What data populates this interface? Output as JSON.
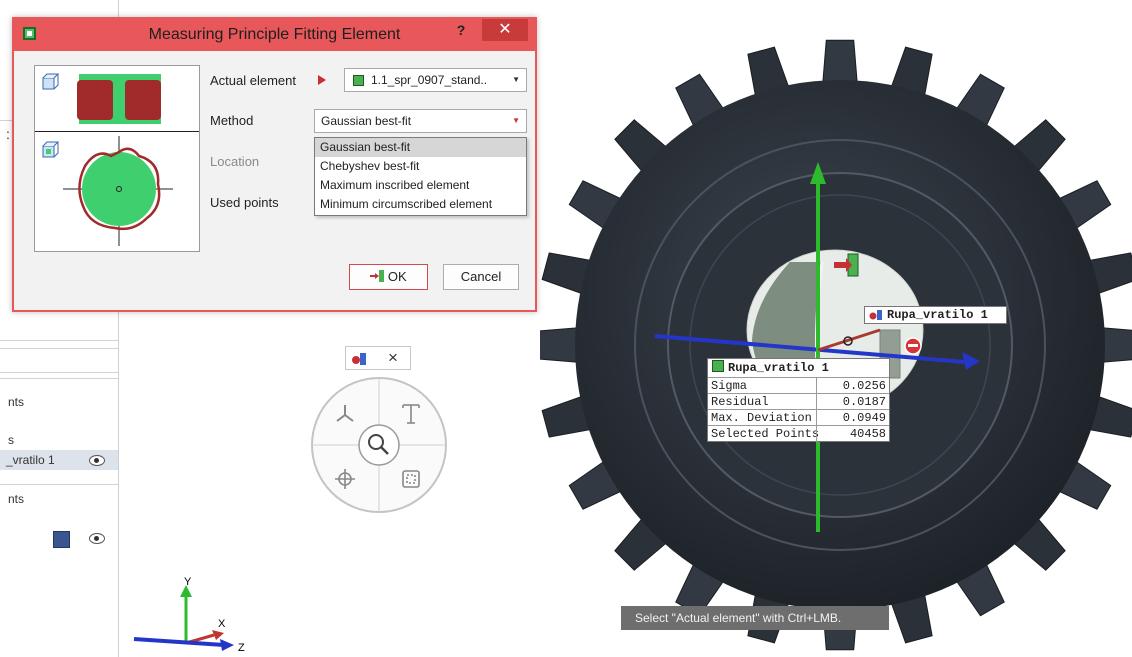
{
  "dialog": {
    "title": "Measuring Principle Fitting Element",
    "help_label": "?",
    "close_label": "✕",
    "fields": {
      "actual_element_label": "Actual element",
      "actual_element_value": "1.1_spr_0907_stand..",
      "method_label": "Method",
      "method_value": "Gaussian best-fit",
      "location_label": "Location",
      "used_points_label": "Used points"
    },
    "method_options": [
      "Gaussian best-fit",
      "Chebyshev best-fit",
      "Maximum inscribed element",
      "Minimum circumscribed element"
    ],
    "ok_label": "OK",
    "cancel_label": "Cancel"
  },
  "left_panel": {
    "items": [
      {
        "label": "nts"
      },
      {
        "label": "s"
      },
      {
        "label": "_vratilo 1"
      },
      {
        "label": "nts"
      }
    ]
  },
  "radial_tool": {
    "close_label": "×"
  },
  "viewport": {
    "element_label": "Rupa_vratilo 1",
    "info_table": {
      "title": "Rupa_vratilo 1",
      "rows": [
        {
          "name": "Sigma",
          "value": "0.0256"
        },
        {
          "name": "Residual",
          "value": "0.0187"
        },
        {
          "name": "Max. Deviation",
          "value": "0.0949"
        },
        {
          "name": "Selected Points",
          "value": "40458"
        }
      ]
    },
    "axes": {
      "y": "Y",
      "x": "X",
      "z": "Z"
    },
    "status_tip": "Select \"Actual element\" with Ctrl+LMB."
  },
  "colors": {
    "dialog_accent": "#e8585a",
    "gear": "#2b3139",
    "axis_y": "#2dbb2d",
    "axis_x": "#c0362e",
    "axis_z": "#2436c8",
    "fit_fill": "#3fcf6f"
  }
}
